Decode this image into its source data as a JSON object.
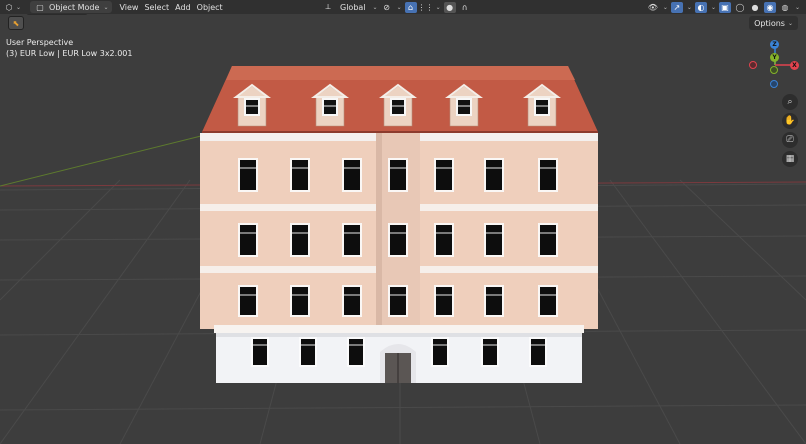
{
  "header": {
    "editor_icon": "3d-viewport-icon",
    "mode": "Object Mode",
    "menus": [
      "View",
      "Select",
      "Add",
      "Object"
    ],
    "orientation": "Global",
    "options_label": "Options"
  },
  "viewport": {
    "perspective_label": "User Perspective",
    "object_label": "(3) EUR Low | EUR Low 3x2.001"
  },
  "gizmo": {
    "z": "Z",
    "y": "Y",
    "x": "X"
  },
  "colors": {
    "background": "#3d3d3d",
    "header": "#303030",
    "accent": "#4772b3",
    "x_axis": "#e2434e",
    "y_axis": "#84b32a",
    "z_axis": "#3a83d6",
    "roof": "#c25a45",
    "facade_upper": "#efcfbc",
    "facade_ground": "#f2f3f6"
  }
}
